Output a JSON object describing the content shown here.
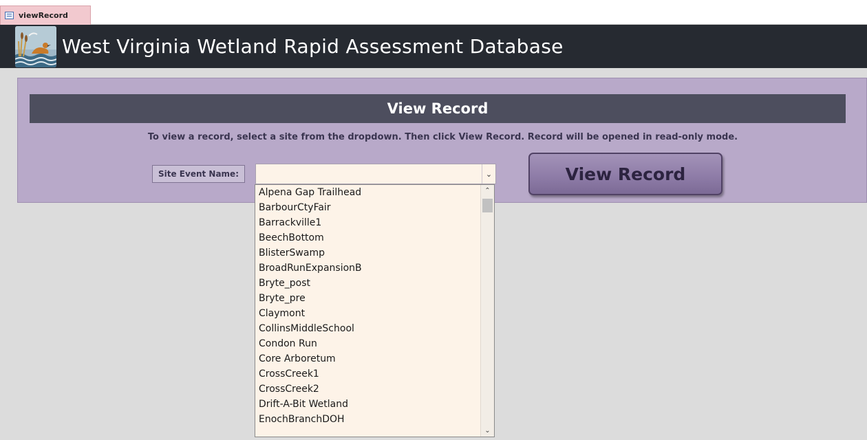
{
  "tab": {
    "label": "viewRecord"
  },
  "header": {
    "title": "West Virginia Wetland Rapid Assessment Database"
  },
  "panel": {
    "title": "View Record",
    "instructions": "To view a record, select a site from the dropdown.  Then click View Record.  Record will be opened in read-only mode.",
    "field_label": "Site Event Name:",
    "combo_value": "",
    "button_label": "View Record"
  },
  "dropdown": {
    "items": [
      "Alpena Gap Trailhead",
      "BarbourCtyFair",
      "Barrackville1",
      "BeechBottom",
      "BlisterSwamp",
      "BroadRunExpansionB",
      "Bryte_post",
      "Bryte_pre",
      "Claymont",
      "CollinsMiddleSchool",
      "Condon Run",
      "Core Arboretum",
      "CrossCreek1",
      "CrossCreek2",
      "Drift-A-Bit Wetland",
      "EnochBranchDOH"
    ]
  },
  "icons": {
    "tab_icon": "form-icon",
    "logo": "wetland-logo-icon",
    "combo_arrow": "chevron-down-icon",
    "scroll_up": "chevron-up-icon",
    "scroll_down": "chevron-down-icon"
  }
}
